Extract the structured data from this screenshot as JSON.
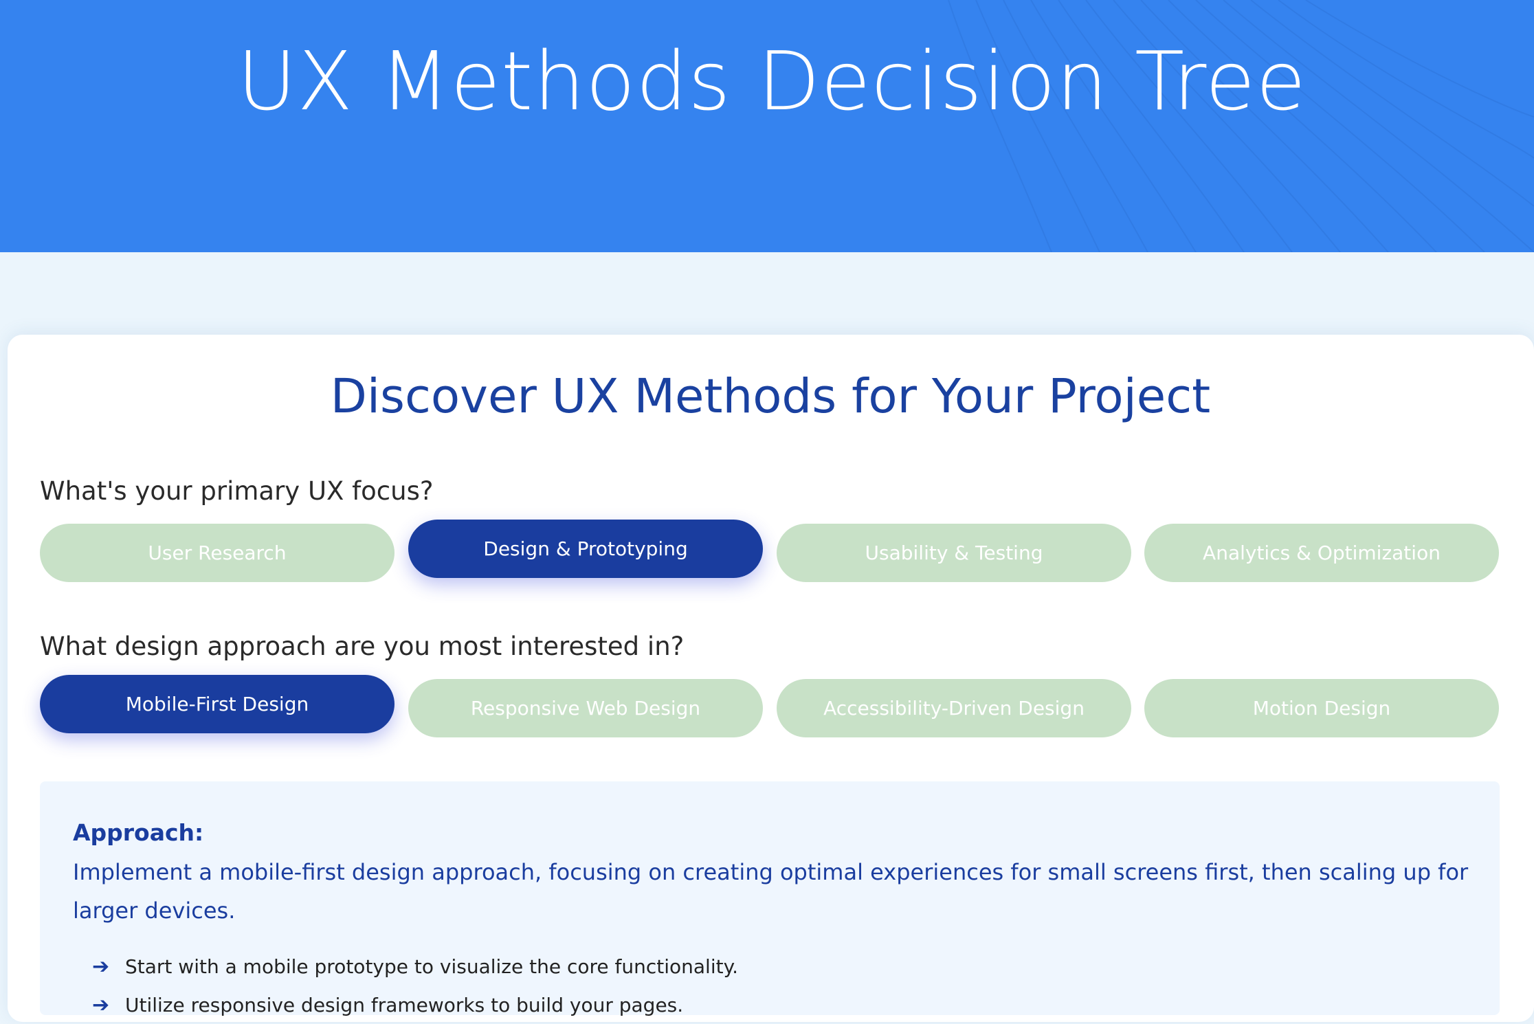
{
  "header": {
    "title": "UX Methods Decision Tree"
  },
  "main": {
    "title": "Discover UX Methods for Your Project",
    "questions": [
      {
        "label": "What's your primary UX focus?",
        "options": [
          {
            "label": "User Research",
            "selected": false
          },
          {
            "label": "Design & Prototyping",
            "selected": true
          },
          {
            "label": "Usability & Testing",
            "selected": false
          },
          {
            "label": "Analytics & Optimization",
            "selected": false
          }
        ]
      },
      {
        "label": "What design approach are you most interested in?",
        "options": [
          {
            "label": "Mobile-First Design",
            "selected": true
          },
          {
            "label": "Responsive Web Design",
            "selected": false
          },
          {
            "label": "Accessibility-Driven Design",
            "selected": false
          },
          {
            "label": "Motion Design",
            "selected": false
          }
        ]
      }
    ],
    "result": {
      "heading": "Approach:",
      "description": "Implement a mobile-first design approach, focusing on creating optimal experiences for small screens first, then scaling up for larger devices.",
      "steps": [
        "Start with a mobile prototype to visualize the core functionality.",
        "Utilize responsive design frameworks to build your pages."
      ],
      "arrow_icon": "➔"
    }
  },
  "colors": {
    "header_bg": "#3583ef",
    "page_bg": "#ebf5fc",
    "accent": "#1a3d9f",
    "option_unselected": "#c8e1c7",
    "result_bg": "#eff6fe"
  }
}
